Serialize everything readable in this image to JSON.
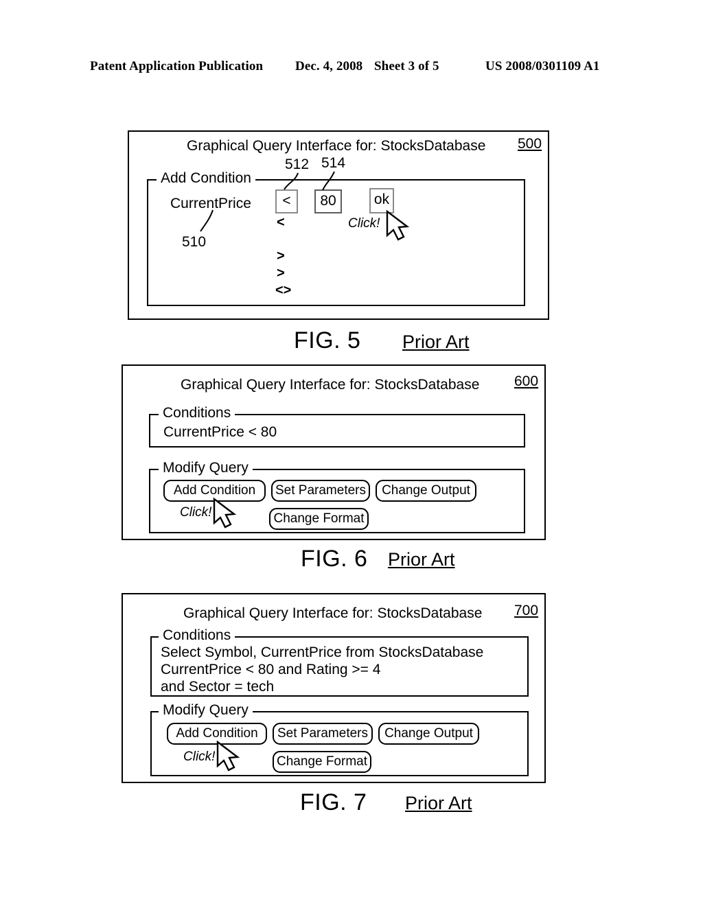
{
  "header": {
    "publication": "Patent Application Publication",
    "date": "Dec. 4, 2008",
    "sheet": "Sheet 3 of 5",
    "patent_number": "US 2008/0301109 A1"
  },
  "figures": [
    {
      "id": "fig5",
      "caption": "FIG. 5",
      "prior_art": "Prior Art",
      "window_ref": "500",
      "title": "Graphical Query Interface for:  StocksDatabase",
      "group_label": "Add Condition",
      "field_name": "CurrentPrice",
      "field_ref": "510",
      "operator_ref": "512",
      "value_ref": "514",
      "operator_value": "<",
      "value_value": "80",
      "ok_label": "ok",
      "click_label": "Click!",
      "operator_options": [
        "<",
        "",
        ">",
        ">",
        "<>"
      ]
    },
    {
      "id": "fig6",
      "caption": "FIG. 6",
      "prior_art": "Prior Art",
      "window_ref": "600",
      "title": "Graphical Query Interface for:  StocksDatabase",
      "conditions_label": "Conditions",
      "conditions_text": "CurrentPrice < 80",
      "modify_label": "Modify Query",
      "click_label": "Click!",
      "buttons_row1": [
        "Add Condition",
        "Set Parameters",
        "Change Output"
      ],
      "buttons_row2": [
        "Change Format"
      ]
    },
    {
      "id": "fig7",
      "caption": "FIG. 7",
      "prior_art": "Prior Art",
      "window_ref": "700",
      "title": "Graphical Query Interface for:  StocksDatabase",
      "conditions_label": "Conditions",
      "conditions_text": "Select Symbol, CurrentPrice from StocksDatabase\nCurrentPrice < 80 and Rating >= 4\nand Sector = tech",
      "modify_label": "Modify Query",
      "click_label": "Click!",
      "buttons_row1": [
        "Add Condition",
        "Set Parameters",
        "Change Output"
      ],
      "buttons_row2": [
        "Change Format"
      ]
    }
  ],
  "colors": {
    "ink": "#000000",
    "cell_border": "#8a8a8a",
    "page_background": "#ffffff"
  }
}
